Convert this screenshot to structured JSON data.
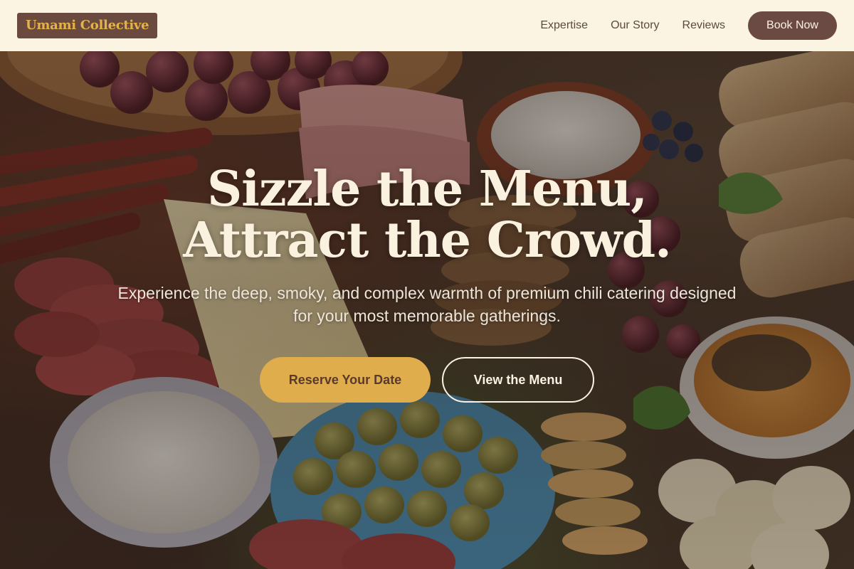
{
  "brand": {
    "name": "Umami Collective"
  },
  "nav": {
    "links": [
      "Expertise",
      "Our Story",
      "Reviews"
    ],
    "cta_label": "Book Now"
  },
  "hero": {
    "title_line1": "Sizzle the Menu,",
    "title_line2": "Attract the Crowd.",
    "subtitle": "Experience the deep, smoky, and complex warmth of premium chili catering designed for your most memorable gatherings.",
    "primary_cta": "Reserve Your Date",
    "secondary_cta": "View the Menu",
    "background_image": "charcuterie-food-spread"
  },
  "colors": {
    "nav_bg": "#fbf4e2",
    "brand_bg": "#6a4a3e",
    "brand_text": "#e3b34a",
    "accent_gold": "#e0ad4c",
    "nav_button": "#6a4a42"
  }
}
